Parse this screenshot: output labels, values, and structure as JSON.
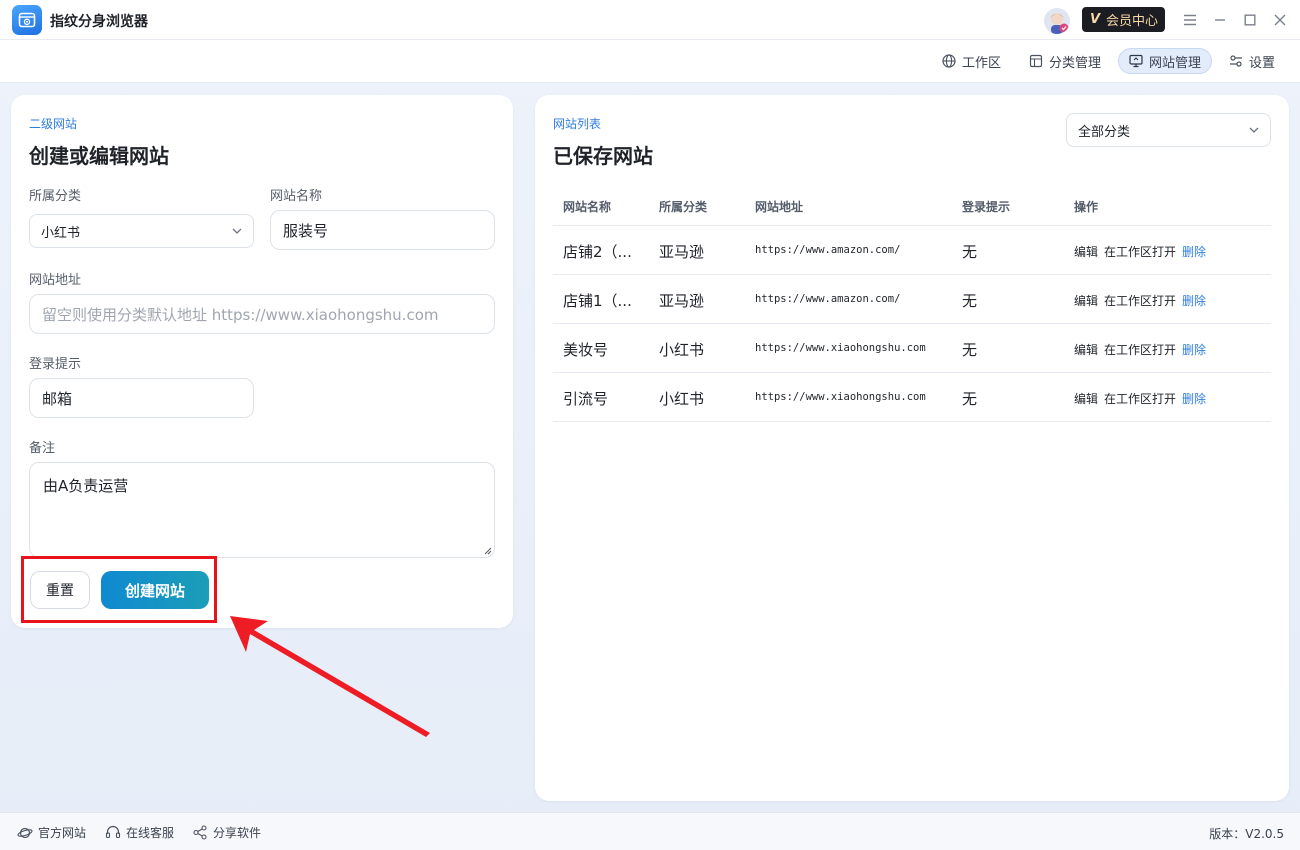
{
  "app": {
    "title": "指纹分身浏览器"
  },
  "titlebar": {
    "vip_label": "会员中心",
    "vip_letter": "V"
  },
  "nav": {
    "items": [
      {
        "label": "工作区",
        "icon": "globe-icon"
      },
      {
        "label": "分类管理",
        "icon": "layout-icon"
      },
      {
        "label": "网站管理",
        "icon": "monitor-icon",
        "active": true
      },
      {
        "label": "设置",
        "icon": "sliders-icon"
      }
    ]
  },
  "form": {
    "eyebrow": "二级网站",
    "title": "创建或编辑网站",
    "category_label": "所属分类",
    "category_value": "小红书",
    "name_label": "网站名称",
    "name_value": "服装号",
    "url_label": "网站地址",
    "url_placeholder": "留空则使用分类默认地址 https://www.xiaohongshu.com",
    "login_label": "登录提示",
    "login_value": "邮箱",
    "note_label": "备注",
    "note_value": "由A负责运营",
    "reset_label": "重置",
    "create_label": "创建网站"
  },
  "list": {
    "eyebrow": "网站列表",
    "title": "已保存网站",
    "filter_value": "全部分类",
    "headers": [
      "网站名称",
      "所属分类",
      "网站地址",
      "登录提示",
      "操作"
    ],
    "rows": [
      {
        "name": "店铺2（...",
        "category": "亚马逊",
        "url": "https://www.amazon.com/",
        "login": "无"
      },
      {
        "name": "店铺1（...",
        "category": "亚马逊",
        "url": "https://www.amazon.com/",
        "login": "无"
      },
      {
        "name": "美妆号",
        "category": "小红书",
        "url": "https://www.xiaohongshu.com",
        "login": "无"
      },
      {
        "name": "引流号",
        "category": "小红书",
        "url": "https://www.xiaohongshu.com",
        "login": "无"
      }
    ],
    "op_edit": "编辑",
    "op_open": "在工作区打开",
    "op_delete": "删除"
  },
  "footer": {
    "official_site": "官方网站",
    "support": "在线客服",
    "share": "分享软件",
    "version": "版本：V2.0.5"
  },
  "colors": {
    "accent": "#2f7de1",
    "highlight": "#e8141b",
    "button": "#0f8ad1"
  }
}
